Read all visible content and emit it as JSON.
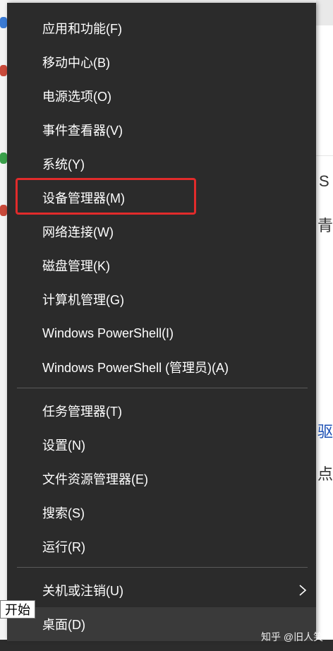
{
  "menu": {
    "items": [
      {
        "label": "应用和功能(F)"
      },
      {
        "label": "移动中心(B)"
      },
      {
        "label": "电源选项(O)"
      },
      {
        "label": "事件查看器(V)"
      },
      {
        "label": "系统(Y)"
      },
      {
        "label": "设备管理器(M)"
      },
      {
        "label": "网络连接(W)"
      },
      {
        "label": "磁盘管理(K)"
      },
      {
        "label": "计算机管理(G)"
      },
      {
        "label": "Windows PowerShell(I)"
      },
      {
        "label": "Windows PowerShell (管理员)(A)"
      },
      {
        "label": "任务管理器(T)"
      },
      {
        "label": "设置(N)"
      },
      {
        "label": "文件资源管理器(E)"
      },
      {
        "label": "搜索(S)"
      },
      {
        "label": "运行(R)"
      },
      {
        "label": "关机或注销(U)"
      },
      {
        "label": "桌面(D)"
      }
    ],
    "highlighted_item": "设备管理器(M)",
    "highlight_color": "#e12b2b",
    "background_color": "#2b2b2b"
  },
  "tooltip": {
    "text": "开始"
  },
  "watermark": {
    "text": "知乎 @旧人笑"
  },
  "background_fragments": {
    "frag1": "S",
    "frag2": "青",
    "frag3": "驱",
    "frag4": "点"
  }
}
